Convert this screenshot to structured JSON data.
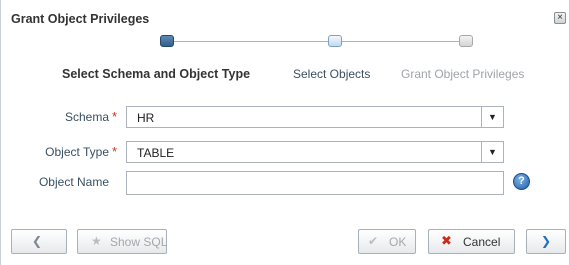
{
  "dialog": {
    "title": "Grant Object Privileges",
    "close_glyph": "×"
  },
  "train": {
    "steps": [
      {
        "label": "Select Schema and Object Type",
        "state": "active"
      },
      {
        "label": "Select Objects",
        "state": "next"
      },
      {
        "label": "Grant Object Privileges",
        "state": "disabled"
      }
    ]
  },
  "form": {
    "schema": {
      "label": "Schema",
      "required": "*",
      "value": "HR"
    },
    "object_type": {
      "label": "Object Type",
      "required": "*",
      "value": "TABLE"
    },
    "object_name": {
      "label": "Object Name",
      "value": "",
      "help": "?"
    }
  },
  "footer": {
    "back_icon": "chevron-left-icon",
    "show_sql_label": "Show SQL",
    "ok_label": "OK",
    "cancel_label": "Cancel",
    "next_icon": "chevron-right-icon"
  },
  "icons": {
    "dropdown": "▼",
    "back": "❮",
    "next": "❯",
    "star": "★",
    "check": "✔",
    "x": "✖"
  },
  "colors": {
    "accent": "#2f5f8c",
    "required": "#d03020",
    "cancel_icon": "#cc2a1a",
    "next_arrow": "#1f6fc0"
  }
}
